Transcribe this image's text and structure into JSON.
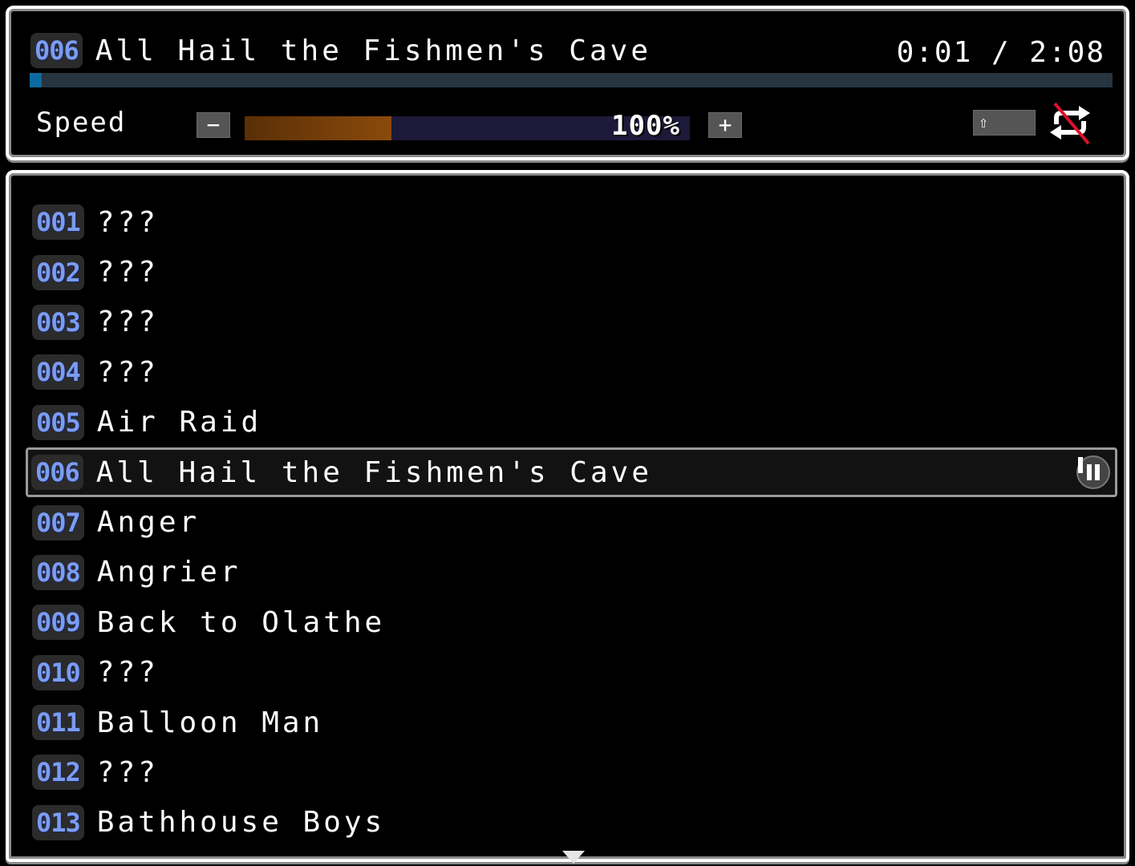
{
  "now_playing": {
    "number": "006",
    "title": "All Hail the Fishmen's Cave",
    "time_elapsed": "0:01",
    "time_total": "2:08",
    "time_display": "0:01 / 2:08",
    "progress_fraction": 0.008
  },
  "speed": {
    "label": "Speed",
    "minus_label": "−",
    "plus_label": "+",
    "value_text": "100%",
    "fill_fraction": 0.33
  },
  "controls": {
    "shift_icon": "⇧",
    "repeat_state": "off"
  },
  "colors": {
    "badge_number": "#7b9cf0",
    "progress_fill": "#0d6aa0",
    "progress_track": "#263540",
    "speed_fill": "#8a4a0c",
    "speed_track": "#1c1a38",
    "repeat_off_slash": "#e0102a"
  },
  "tracks": [
    {
      "number": "001",
      "title": "???"
    },
    {
      "number": "002",
      "title": "???"
    },
    {
      "number": "003",
      "title": "???"
    },
    {
      "number": "004",
      "title": "???"
    },
    {
      "number": "005",
      "title": "Air Raid"
    },
    {
      "number": "006",
      "title": "All Hail the Fishmen's Cave",
      "selected": true,
      "playing": true
    },
    {
      "number": "007",
      "title": "Anger"
    },
    {
      "number": "008",
      "title": "Angrier"
    },
    {
      "number": "009",
      "title": "Back to Olathe"
    },
    {
      "number": "010",
      "title": "???"
    },
    {
      "number": "011",
      "title": "Balloon Man"
    },
    {
      "number": "012",
      "title": "???"
    },
    {
      "number": "013",
      "title": "Bathhouse Boys"
    }
  ]
}
